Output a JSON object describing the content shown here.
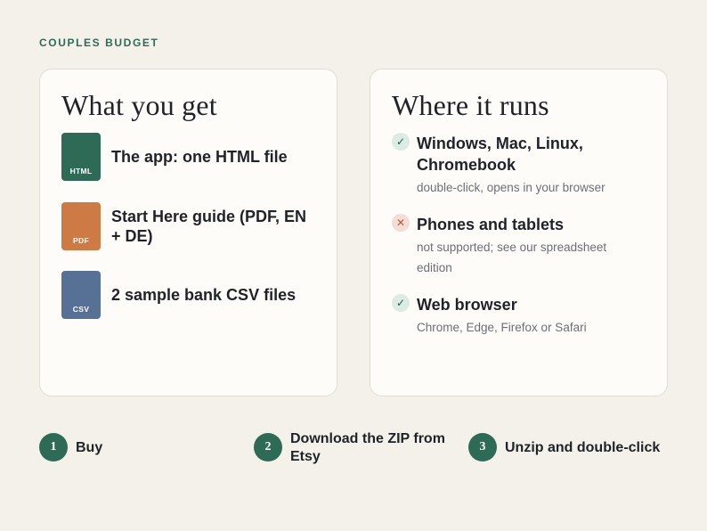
{
  "brand": "COUPLES BUDGET",
  "colors": {
    "accent": "#2e6b57",
    "html_file": "#2e6b57",
    "pdf_file": "#cd7a45",
    "csv_file": "#567096",
    "check_bg": "#dcebe3",
    "cross_bg": "#f3ddd4"
  },
  "what_you_get": {
    "title": "What you get",
    "items": [
      {
        "ext": "HTML",
        "label": "The app: one HTML file",
        "icon": "html-file-icon"
      },
      {
        "ext": "PDF",
        "label": "Start Here guide (PDF, EN + DE)",
        "icon": "pdf-file-icon"
      },
      {
        "ext": "CSV",
        "label": "2 sample bank CSV files",
        "icon": "csv-file-icon"
      }
    ]
  },
  "where_it_runs": {
    "title": "Where it runs",
    "items": [
      {
        "icon": "check-icon",
        "symbol": "✓",
        "title": "Windows, Mac, Linux, Chromebook",
        "sub": "double-click, opens in your browser"
      },
      {
        "icon": "cross-icon",
        "symbol": "✕",
        "title": "Phones and tablets",
        "sub": "not supported; see our spreadsheet edition"
      },
      {
        "icon": "check-icon",
        "symbol": "✓",
        "title": "Web browser",
        "sub": "Chrome, Edge, Firefox or Safari"
      }
    ]
  },
  "steps": [
    {
      "num": "1",
      "label": "Buy"
    },
    {
      "num": "2",
      "label": "Download the ZIP from Etsy"
    },
    {
      "num": "3",
      "label": "Unzip and double-click"
    }
  ]
}
